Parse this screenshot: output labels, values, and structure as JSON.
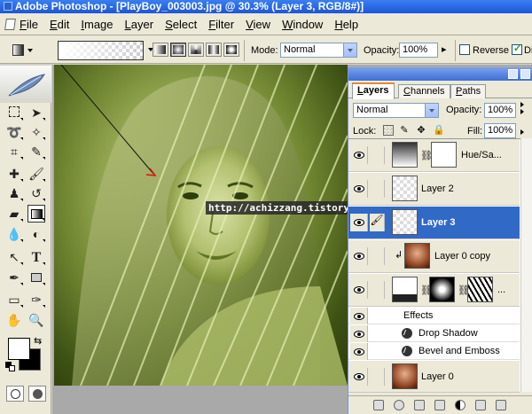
{
  "window": {
    "title": "Adobe Photoshop - [PlayBoy_003003.jpg @ 30.3% (Layer 3, RGB/8#)]"
  },
  "menu": [
    {
      "label": "File",
      "key": "F",
      "rest": "ile"
    },
    {
      "label": "Edit",
      "key": "E",
      "rest": "dit"
    },
    {
      "label": "Image",
      "key": "I",
      "rest": "mage"
    },
    {
      "label": "Layer",
      "key": "L",
      "rest": "ayer"
    },
    {
      "label": "Select",
      "key": "S",
      "rest": "elect"
    },
    {
      "label": "Filter",
      "key": "F",
      "rest": "ilter"
    },
    {
      "label": "View",
      "key": "V",
      "rest": "iew"
    },
    {
      "label": "Window",
      "key": "W",
      "rest": "indow"
    },
    {
      "label": "Help",
      "key": "H",
      "rest": "elp"
    }
  ],
  "options": {
    "mode_label": "Mode:",
    "mode_value": "Normal",
    "opacity_label": "Opacity:",
    "opacity_value": "100%",
    "reverse_label": "Reverse",
    "dither_label": "Di"
  },
  "canvas": {
    "watermark": "http://achizzang.tistory.com",
    "tint_colors": [
      "#c9d491",
      "#9fb05a",
      "#6f8430",
      "#3e5214"
    ]
  },
  "layers_panel": {
    "tabs": [
      {
        "key": "L",
        "rest": "ayers",
        "active": true
      },
      {
        "key": "C",
        "rest": "hannels",
        "active": false
      },
      {
        "key": "P",
        "rest": "aths",
        "active": false
      }
    ],
    "blend_mode": "Normal",
    "opacity_label": "Opacity:",
    "opacity_value": "100%",
    "lock_label": "Lock:",
    "fill_label": "Fill:",
    "fill_value": "100%",
    "layers": [
      {
        "name": "Hue/Sa...",
        "selected": false
      },
      {
        "name": "Layer 2",
        "selected": false
      },
      {
        "name": "Layer 3",
        "selected": true
      },
      {
        "name": "Layer 0 copy",
        "selected": false
      },
      {
        "name": "...",
        "selected": false
      }
    ],
    "effects_label": "Effects",
    "effects": [
      "Drop Shadow",
      "Bevel and Emboss"
    ],
    "bottom_layer": "Layer 0"
  },
  "selection_color": "#3169c6"
}
